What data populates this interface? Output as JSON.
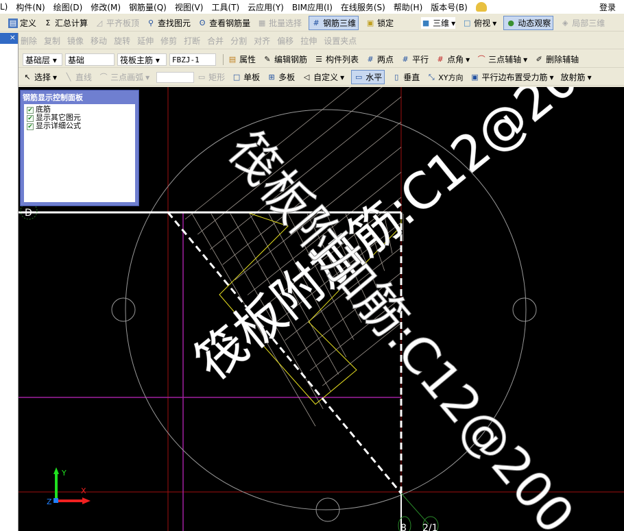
{
  "menu": [
    "L)",
    "构件(N)",
    "绘图(D)",
    "修改(M)",
    "钢筋量(Q)",
    "视图(V)",
    "工具(T)",
    "云应用(Y)",
    "BIM应用(I)",
    "在线服务(S)",
    "帮助(H)",
    "版本号(B)"
  ],
  "login": "登录",
  "toolbar1": {
    "define": "定义",
    "sum": "汇总计算",
    "align_top": "平齐板顶",
    "find": "查找图元",
    "view_rebar": "查看钢筋量",
    "batch_select": "批量选择",
    "rebar_3d": "钢筋三维",
    "lock": "锁定",
    "view3d": "三维",
    "top_view": "俯视",
    "dynamic": "动态观察",
    "local3d": "局部三维"
  },
  "toolbar2": [
    "删除",
    "复制",
    "镜像",
    "移动",
    "旋转",
    "延伸",
    "修剪",
    "打断",
    "合并",
    "分割",
    "对齐",
    "偏移",
    "拉伸",
    "设置夹点"
  ],
  "toolbar3": {
    "layer": "基础层",
    "category": "基础",
    "type": "筏板主筋",
    "name": "FBZJ-1",
    "props": "属性",
    "edit_rebar": "编辑钢筋",
    "list": "构件列表",
    "two_point": "两点",
    "parallel": "平行",
    "point_angle": "点角",
    "three_point_axis": "三点辅轴",
    "delete_axis": "删除辅轴"
  },
  "toolbar4": {
    "select": "选择",
    "line": "直线",
    "arc": "三点画弧",
    "rect": "矩形",
    "single": "单板",
    "multi": "多板",
    "custom": "自定义",
    "horizontal": "水平",
    "vertical": "垂直",
    "xy": "XY方向",
    "parallel_edge": "平行边布置受力筋",
    "radial": "放射筋"
  },
  "panel": {
    "title": "钢筋显示控制面板",
    "items": [
      "底筋",
      "显示其它图元",
      "显示详细公式"
    ]
  },
  "canvas": {
    "rebar_label": "筏板附加筋:C12@200",
    "axis_d": "D",
    "axis_8": "8",
    "axis_21": "2/1",
    "x": "X",
    "y": "Y",
    "z": "Z"
  }
}
